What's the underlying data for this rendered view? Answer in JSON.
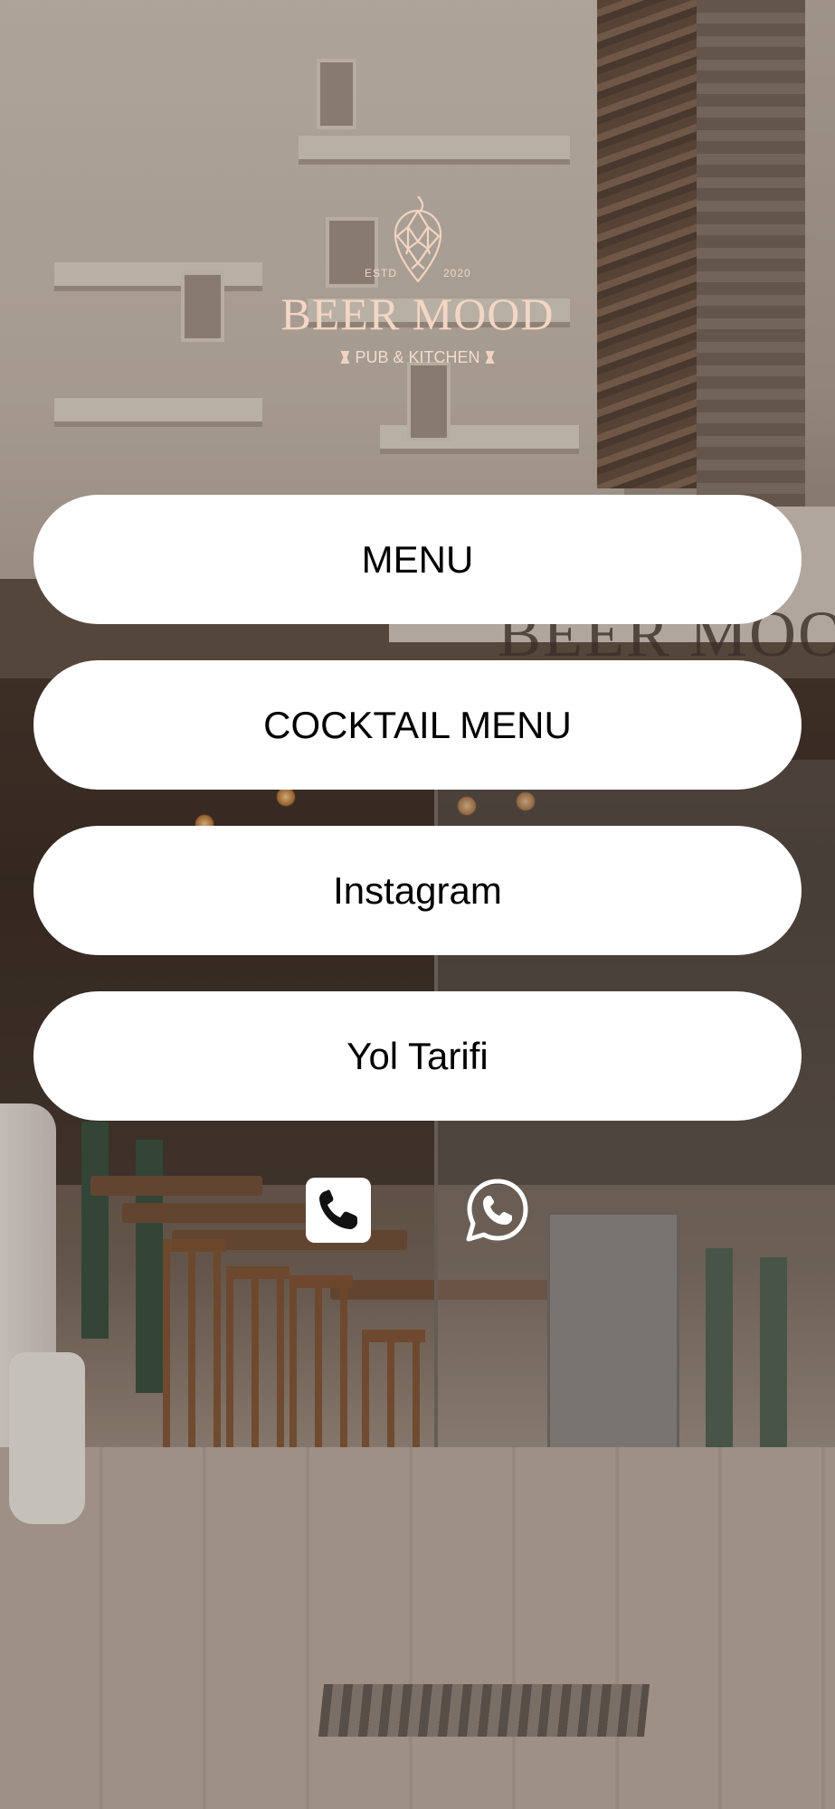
{
  "brand": {
    "estd_label": "ESTD",
    "year": "2020",
    "name": "BEER MOOD",
    "tagline": "PUB & KITCHEN",
    "color": "#f3d6c4"
  },
  "links": [
    {
      "label": "MENU"
    },
    {
      "label": "COCKTAIL MENU"
    },
    {
      "label": "Instagram"
    },
    {
      "label": "Yol Tarifi"
    }
  ],
  "contact": {
    "phone_icon": "phone-icon",
    "whatsapp_icon": "whatsapp-icon"
  },
  "background": {
    "storefront_sign": "BEER MOO"
  },
  "colors": {
    "button_bg": "#ffffff",
    "button_text": "#000000"
  }
}
